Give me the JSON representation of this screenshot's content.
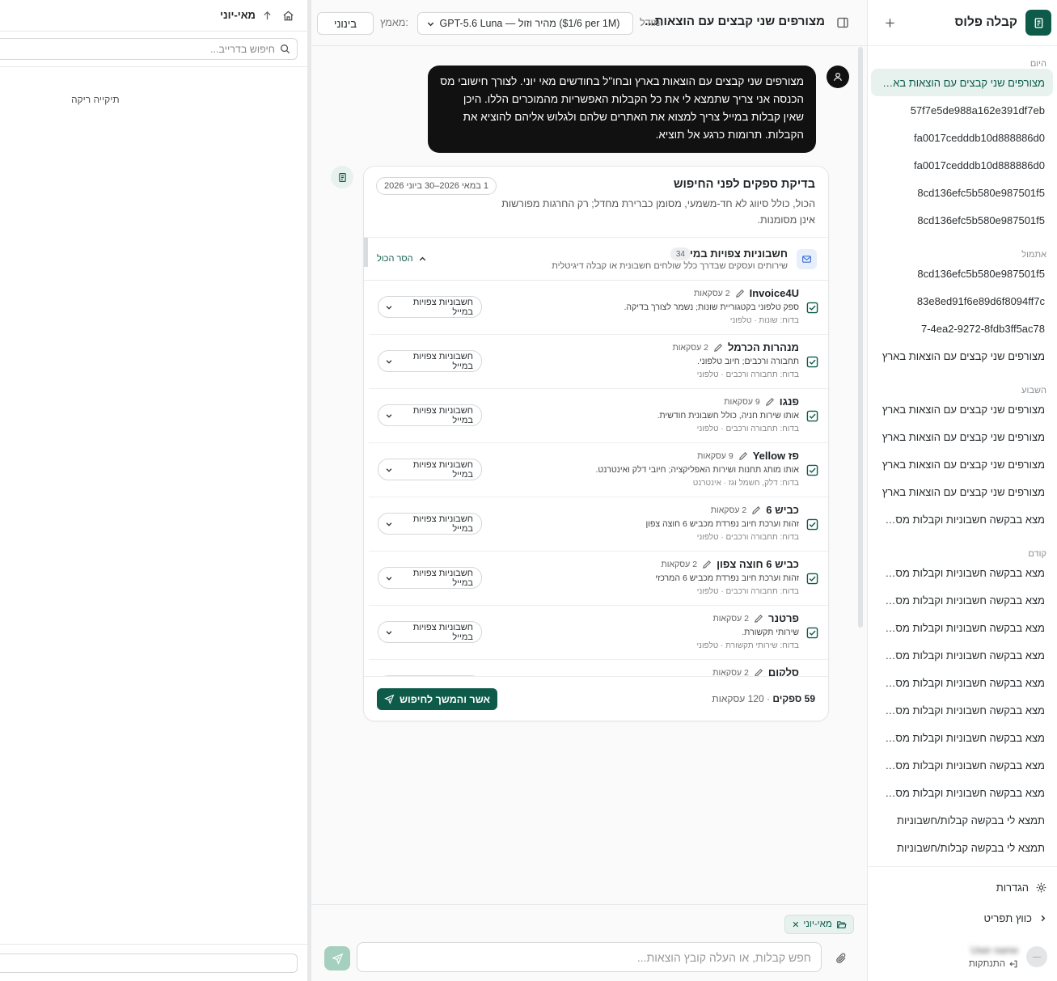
{
  "sidebar": {
    "brand": "קבלה פלוס",
    "groups": [
      {
        "label": "היום",
        "items": [
          {
            "title": "מצורפים שני קבצים עם הוצאות בארץ ובחו\"ל",
            "active": true
          },
          {
            "title": "57f7e5de988a162e391df7eb"
          },
          {
            "title": "fa0017cedddb10d888886d0"
          },
          {
            "title": "fa0017cedddb10d888886d0"
          },
          {
            "title": "8cd136efc5b580e987501f5"
          },
          {
            "title": "8cd136efc5b580e987501f5"
          }
        ]
      },
      {
        "label": "אתמול",
        "items": [
          {
            "title": "8cd136efc5b580e987501f5"
          },
          {
            "title": "83e8ed91f6e89d6f8094ff7c"
          },
          {
            "title": "7-4ea2-9272-8fdb3ff5ac78"
          },
          {
            "title": "מצורפים שני קבצים עם הוצאות בארץ"
          }
        ]
      },
      {
        "label": "השבוע",
        "items": [
          {
            "title": "מצורפים שני קבצים עם הוצאות בארץ"
          },
          {
            "title": "מצורפים שני קבצים עם הוצאות בארץ"
          },
          {
            "title": "מצורפים שני קבצים עם הוצאות בארץ"
          },
          {
            "title": "מצורפים שני קבצים עם הוצאות בארץ"
          },
          {
            "title": "מצא בבקשה חשבוניות וקבלות מספקים"
          }
        ]
      },
      {
        "label": "קודם",
        "items": [
          {
            "title": "מצא בבקשה חשבוניות וקבלות מספקים"
          },
          {
            "title": "מצא בבקשה חשבוניות וקבלות מספקים"
          },
          {
            "title": "מצא בבקשה חשבוניות וקבלות מספקים"
          },
          {
            "title": "מצא בבקשה חשבוניות וקבלות מספקים"
          },
          {
            "title": "מצא בבקשה חשבוניות וקבלות מספקים"
          },
          {
            "title": "מצא בבקשה חשבוניות וקבלות מספקים"
          },
          {
            "title": "מצא בבקשה חשבוניות וקבלות מספקים"
          },
          {
            "title": "מצא בבקשה חשבוניות וקבלות מספקים"
          },
          {
            "title": "מצא בבקשה חשבוניות וקבלות מספקים"
          },
          {
            "title": "תמצא לי בבקשה קבלות/חשבוניות"
          },
          {
            "title": "תמצא לי בבקשה קבלות/חשבוניות"
          }
        ]
      }
    ],
    "settings_label": "הגדרות",
    "collapse_label": "כווץ תפריט",
    "user_name": "User name",
    "logout_label": "התנתקות"
  },
  "topbar": {
    "title": "מצורפים שני קבצים עם הוצאות...",
    "model_label": "מודל:",
    "model_value": "GPT-5.6 Luna — מהיר וזול ($1/6 per 1M)",
    "effort_label": "מאמץ:",
    "effort_value": "בינוני"
  },
  "user_message": "מצורפים שני קבצים עם הוצאות בארץ ובחו\"ל בחודשים מאי יוני. לצורך חישובי מס הכנסה אני צריך שתמצא לי את כל הקבלות האפשריות מהמוכרים הללו. היכן שאין קבלות במייל צריך למצוא את האתרים שלהם ולגלוש אליהם להוציא את הקבלות. תרומות כרגע אל תוציא.",
  "review_card": {
    "title": "בדיקת ספקים לפני החיפוש",
    "date_range": "1 במאי 2026–30 ביוני 2026",
    "description": "הכול, כולל סיווג לא חד-משמעי, מסומן כברירת מחדל; רק החרגות מפורשות אינן מסומנות.",
    "group": {
      "title": "חשבוניות צפויות במייל",
      "count": "34",
      "subtitle": "שירותים ועסקים שבדרך כלל שולחים חשבונית או קבלה דיגיטלית",
      "remove_all": "הסר הכול"
    },
    "vendors": [
      {
        "name": "Invoice4U",
        "count": "2 עסקאות",
        "desc": "ספק טלפוני בקטגוריית שונות; נשמר לצורך בדיקה.",
        "tags": "בדוח: שונות · טלפוני",
        "select": "חשבוניות צפויות במייל"
      },
      {
        "name": "מנהרות הכרמל",
        "count": "2 עסקאות",
        "desc": "תחבורה ורכבים; חיוב טלפוני.",
        "tags": "בדוח: תחבורה ורכבים · טלפוני",
        "select": "חשבוניות צפויות במייל"
      },
      {
        "name": "פנגו",
        "count": "9 עסקאות",
        "desc": "אותו שירות חניה, כולל חשבונית חודשית.",
        "tags": "בדוח: תחבורה ורכבים · טלפוני",
        "select": "חשבוניות צפויות במייל"
      },
      {
        "name": "פז Yellow",
        "count": "9 עסקאות",
        "desc": "אותו מותג תחנות ושירות האפליקציה; חיובי דלק ואינטרנט.",
        "tags": "בדוח: דלק, חשמל וגז · אינטרנט",
        "select": "חשבוניות צפויות במייל"
      },
      {
        "name": "כביש 6",
        "count": "2 עסקאות",
        "desc": "זהות וערכת חיוב נפרדת מכביש 6 חוצה צפון",
        "tags": "בדוח: תחבורה ורכבים · טלפוני",
        "select": "חשבוניות צפויות במייל"
      },
      {
        "name": "כביש 6 חוצה צפון",
        "count": "2 עסקאות",
        "desc": "זהות וערכת חיוב נפרדת מכביש 6 המרכזי",
        "tags": "בדוח: תחבורה ורכבים · טלפוני",
        "select": "חשבוניות צפויות במייל"
      },
      {
        "name": "פרטנר",
        "count": "2 עסקאות",
        "desc": "שירותי תקשורת.",
        "tags": "בדוח: שירותי תקשורת · טלפוני",
        "select": "חשבוניות צפויות במייל"
      },
      {
        "name": "סלקום",
        "count": "2 עסקאות",
        "desc": "",
        "tags": "",
        "select": "חשבוניות צפויות במייל"
      }
    ],
    "footer": {
      "vendors_total": "59 ספקים",
      "transactions_total": "120 עסקאות",
      "confirm_label": "אשר והמשך לחיפוש"
    }
  },
  "composer": {
    "folder_chip": "מאי-יוני",
    "placeholder": "חפש קבלות, או העלה קובץ הוצאות..."
  },
  "left_panel": {
    "title": "מאי-יוני",
    "search_placeholder": "חיפוש בדרייב...",
    "empty_text": "תיקייה ריקה"
  }
}
